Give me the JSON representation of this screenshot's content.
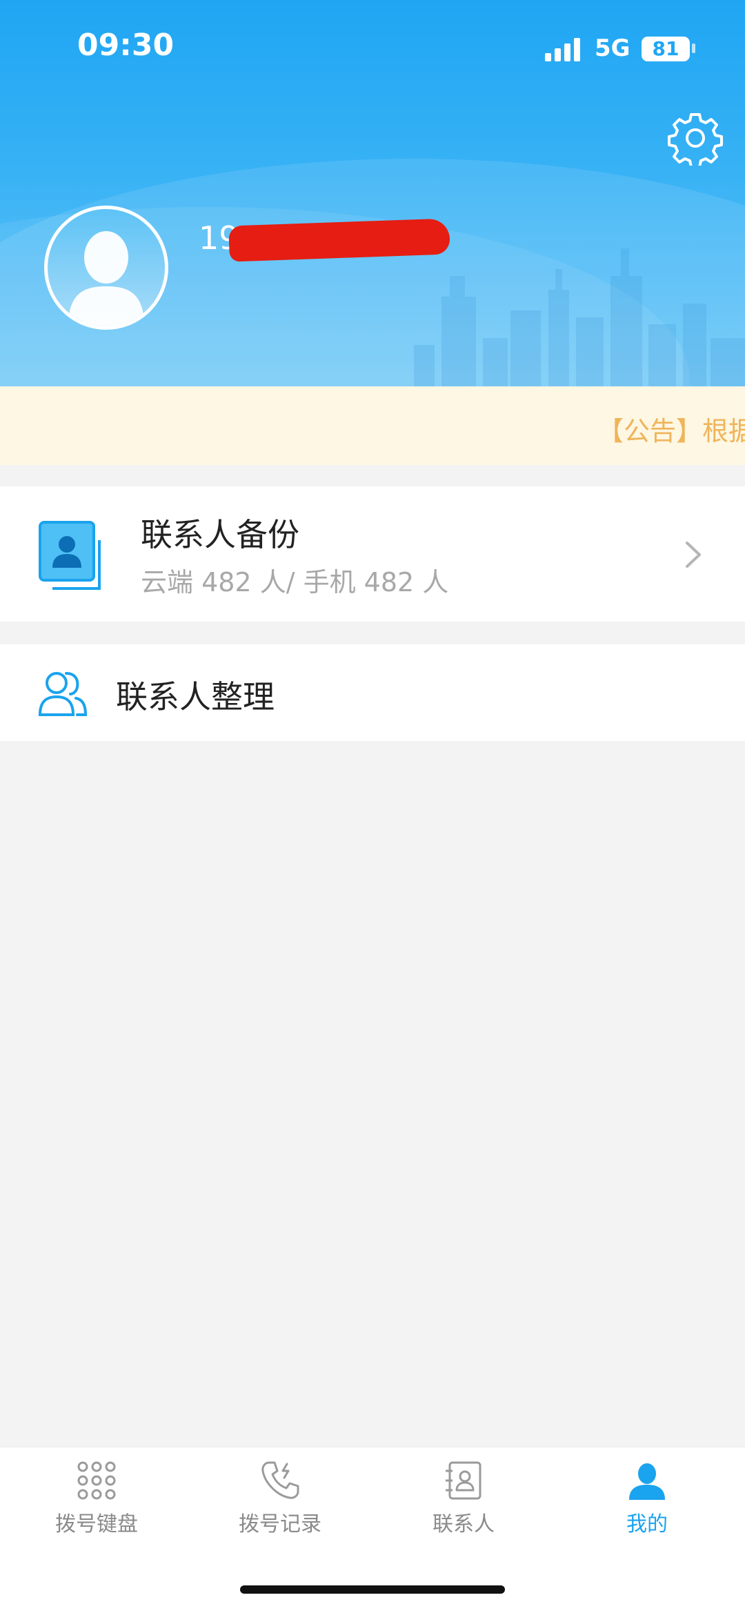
{
  "status_bar": {
    "time": "09:30",
    "network": "5G",
    "battery": "81"
  },
  "header": {
    "phone_number": "19",
    "settings_icon": "gear-icon",
    "avatar_icon": "user-silhouette-icon"
  },
  "notice": {
    "text": "【公告】根据"
  },
  "menu": {
    "backup": {
      "title": "联系人备份",
      "subtitle": "云端 482 人/ 手机 482 人",
      "icon": "contact-card-icon"
    },
    "organize": {
      "title": "联系人整理",
      "icon": "people-icon"
    }
  },
  "tabbar": {
    "tabs": [
      {
        "label": "拨号键盘",
        "icon": "keypad-icon"
      },
      {
        "label": "拨号记录",
        "icon": "call-log-icon"
      },
      {
        "label": "联系人",
        "icon": "contacts-book-icon"
      },
      {
        "label": "我的",
        "icon": "person-icon"
      }
    ],
    "active": "我的",
    "accent_color": "#1aa3ee",
    "inactive_color": "#8a8a8a"
  }
}
